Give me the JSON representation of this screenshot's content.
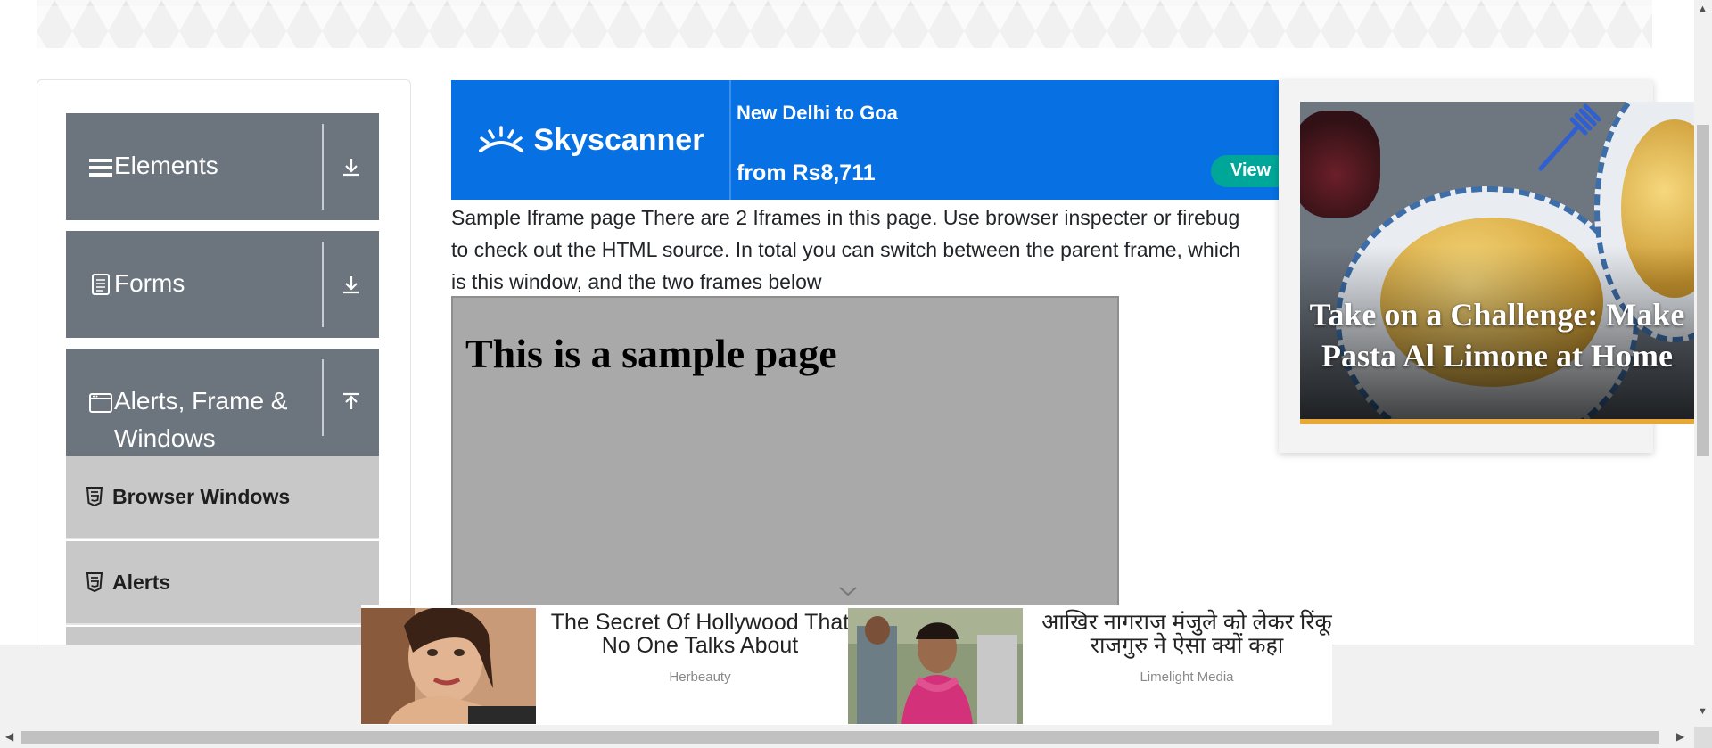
{
  "sidebar": {
    "groups": [
      {
        "label": "Elements",
        "icon": "menu-icon",
        "toggle": "download-arrow-icon"
      },
      {
        "label": "Forms",
        "icon": "document-icon",
        "toggle": "download-arrow-icon"
      },
      {
        "label": "Alerts, Frame &",
        "label2": "Windows",
        "icon": "window-icon",
        "toggle": "upload-arrow-icon"
      }
    ],
    "items": [
      {
        "label": "Browser Windows",
        "icon": "html5-icon"
      },
      {
        "label": "Alerts",
        "icon": "html5-icon"
      }
    ]
  },
  "ad_top": {
    "brand": "Skyscanner",
    "route": "New Delhi to Goa",
    "price": "from Rs8,711",
    "button": "View",
    "colors": {
      "background": "#0770e3",
      "button": "#00a698"
    }
  },
  "main": {
    "description": "Sample Iframe page There are 2 Iframes in this page. Use browser inspecter or firebug to check out the HTML source. In total you can switch between the parent frame, which is this window, and the two frames below",
    "frame_heading": "This is a sample page"
  },
  "ad_right": {
    "headline": "Take on a Challenge: Make Pasta Al Limone at Home"
  },
  "native_ads": [
    {
      "title": "The Secret Of Hollywood That No One Talks About",
      "source": "Herbeauty"
    },
    {
      "title": "आखिर नागराज मंजुले को लेकर रिंकू राजगुरु ने ऐसा क्यों कहा",
      "source": "Limelight Media"
    }
  ],
  "scrollbars": {
    "vertical": "vertical-scrollbar",
    "horizontal": "horizontal-scrollbar"
  }
}
